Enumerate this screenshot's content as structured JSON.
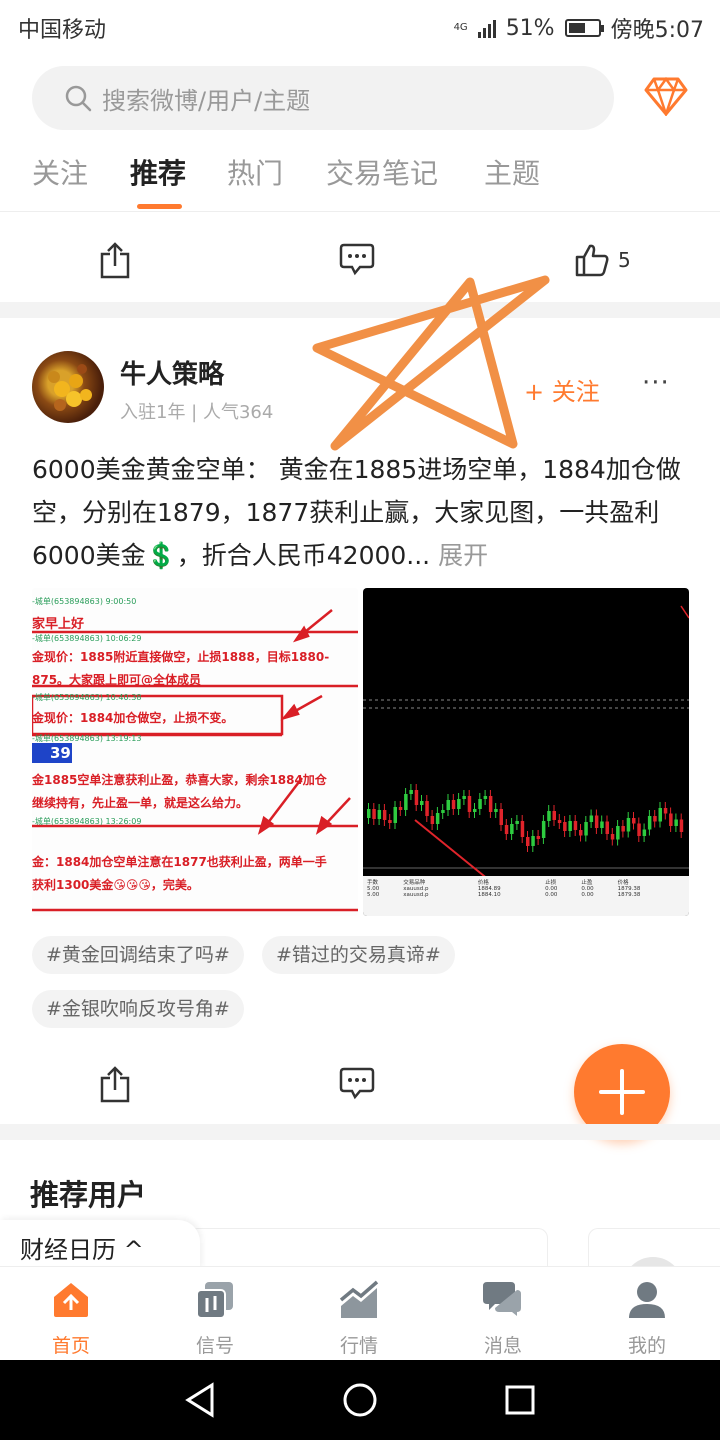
{
  "status": {
    "carrier": "中国移动",
    "network": "4G",
    "battery": "51%",
    "time": "傍晚5:07"
  },
  "search": {
    "placeholder": "搜索微博/用户/主题"
  },
  "tabs": [
    {
      "label": "关注",
      "active": false
    },
    {
      "label": "推荐",
      "active": true
    },
    {
      "label": "热门",
      "active": false
    },
    {
      "label": "交易笔记",
      "active": false
    },
    {
      "label": "主题",
      "active": false
    }
  ],
  "prev_post": {
    "like_count": "5"
  },
  "post": {
    "username": "牛人策略",
    "meta": "入驻1年 | 人气364",
    "follow_label": "+ 关注",
    "more_label": "···",
    "text": "6000美金黄金空单： 黄金在1885进场空单，1884加仓做空，分别在1879，1877获利止赢，大家见图，一共盈利6000美金💲，折合人民币42000...",
    "expand_label": "展开",
    "image1_lines": [
      "家早上好",
      "金现价：1885附近直接做空，止损1888，目标1880-",
      "875。大家跟上即可@全体成员",
      "金现价：1884加仓做空，止损不变。",
      "39",
      "金1885空单注意获利止盈，恭喜大家，剩余1884加仓",
      "继续持有，先止盈一单，就是这么给力。",
      "金：1884加仓空单注意在1877也获利止盈，两单一手",
      "获利1300美金😘😘😘，完美。"
    ],
    "image1_times": [
      "9:00:50",
      "10:06:29",
      "10:40:38",
      "13:19:13",
      "13:26:09"
    ],
    "image1_ids": [
      "653894863",
      "653894863",
      "653894863",
      "653894863"
    ],
    "image2_table": {
      "headers": [
        "手数",
        "交易品种",
        "价格",
        "止损",
        "止盈",
        "价格"
      ],
      "rows": [
        [
          "5.00",
          "xauusd.p",
          "1884.89",
          "0.00",
          "0.00",
          "1879.38"
        ],
        [
          "5.00",
          "xauusd.p",
          "1884.10",
          "0.00",
          "0.00",
          "1879.38"
        ]
      ]
    },
    "tags": [
      "#黄金回调结束了吗#",
      "#错过的交易真谛#",
      "#金银吹响反攻号角#"
    ]
  },
  "recommend": {
    "title": "推荐用户"
  },
  "calendar": {
    "label": "财经日历 ^"
  },
  "bottom_nav": [
    {
      "label": "首页",
      "icon": "home-icon",
      "active": true
    },
    {
      "label": "信号",
      "icon": "signal-icon",
      "active": false
    },
    {
      "label": "行情",
      "icon": "market-icon",
      "active": false
    },
    {
      "label": "消息",
      "icon": "message-icon",
      "active": false
    },
    {
      "label": "我的",
      "icon": "profile-icon",
      "active": false
    }
  ],
  "colors": {
    "accent": "#ff7a2f",
    "text": "#222222",
    "muted": "#999999",
    "chart_bg": "#000000",
    "up": "#2ecc40",
    "down": "#e0242b"
  }
}
